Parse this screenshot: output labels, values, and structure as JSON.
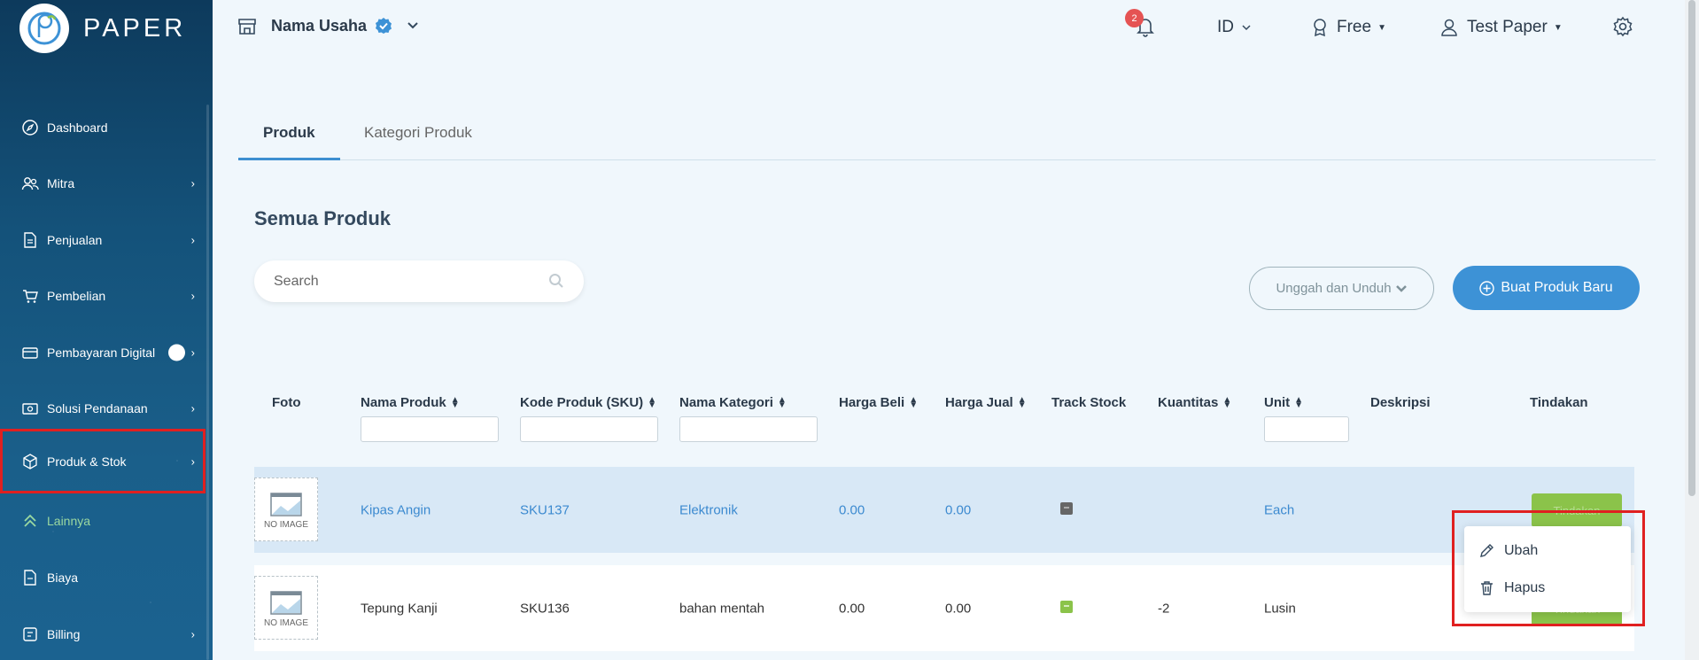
{
  "sidebar": {
    "logo_text": "PAPER",
    "items": [
      {
        "label": "Dashboard",
        "icon": "compass-icon",
        "chevron": false
      },
      {
        "label": "Mitra",
        "icon": "users-icon",
        "chevron": true
      },
      {
        "label": "Penjualan",
        "icon": "document-icon",
        "chevron": true
      },
      {
        "label": "Pembelian",
        "icon": "cart-icon",
        "chevron": true
      },
      {
        "label": "Pembayaran Digital",
        "icon": "card-icon",
        "chevron": true
      },
      {
        "label": "Solusi Pendanaan",
        "icon": "money-icon",
        "chevron": true
      },
      {
        "label": "Produk & Stok",
        "icon": "box-icon",
        "chevron": true
      },
      {
        "label": "Lainnya",
        "icon": "double-chevron-up-icon",
        "chevron": false
      },
      {
        "label": "Biaya",
        "icon": "receipt-icon",
        "chevron": false
      },
      {
        "label": "Billing",
        "icon": "billing-icon",
        "chevron": true
      }
    ]
  },
  "header": {
    "business_name": "Nama Usaha",
    "notification_count": "2",
    "language": "ID",
    "plan": "Free",
    "user": "Test Paper"
  },
  "tabs": [
    {
      "label": "Produk",
      "active": true
    },
    {
      "label": "Kategori Produk",
      "active": false
    }
  ],
  "page": {
    "title": "Semua Produk",
    "search_placeholder": "Search",
    "upload_download_label": "Unggah dan Unduh",
    "new_product_label": "Buat Produk Baru"
  },
  "table": {
    "columns": [
      "Foto",
      "Nama Produk",
      "Kode Produk (SKU)",
      "Nama Kategori",
      "Harga Beli",
      "Harga Jual",
      "Track Stock",
      "Kuantitas",
      "Unit",
      "Deskripsi",
      "Tindakan"
    ],
    "no_image_label": "NO IMAGE",
    "action_label": "Tindakan",
    "rows": [
      {
        "name": "Kipas Angin",
        "sku": "SKU137",
        "category": "Elektronik",
        "buy": "0.00",
        "sell": "0.00",
        "track_color": "#666666",
        "qty": "",
        "unit": "Each"
      },
      {
        "name": "Tepung Kanji",
        "sku": "SKU136",
        "category": "bahan mentah",
        "buy": "0.00",
        "sell": "0.00",
        "track_color": "#8bc34a",
        "qty": "-2",
        "unit": "Lusin"
      }
    ]
  },
  "context_menu": {
    "edit": "Ubah",
    "delete": "Hapus"
  },
  "colors": {
    "accent": "#3d92d6",
    "highlight": "#e02020",
    "action_green": "#8bc34a"
  }
}
